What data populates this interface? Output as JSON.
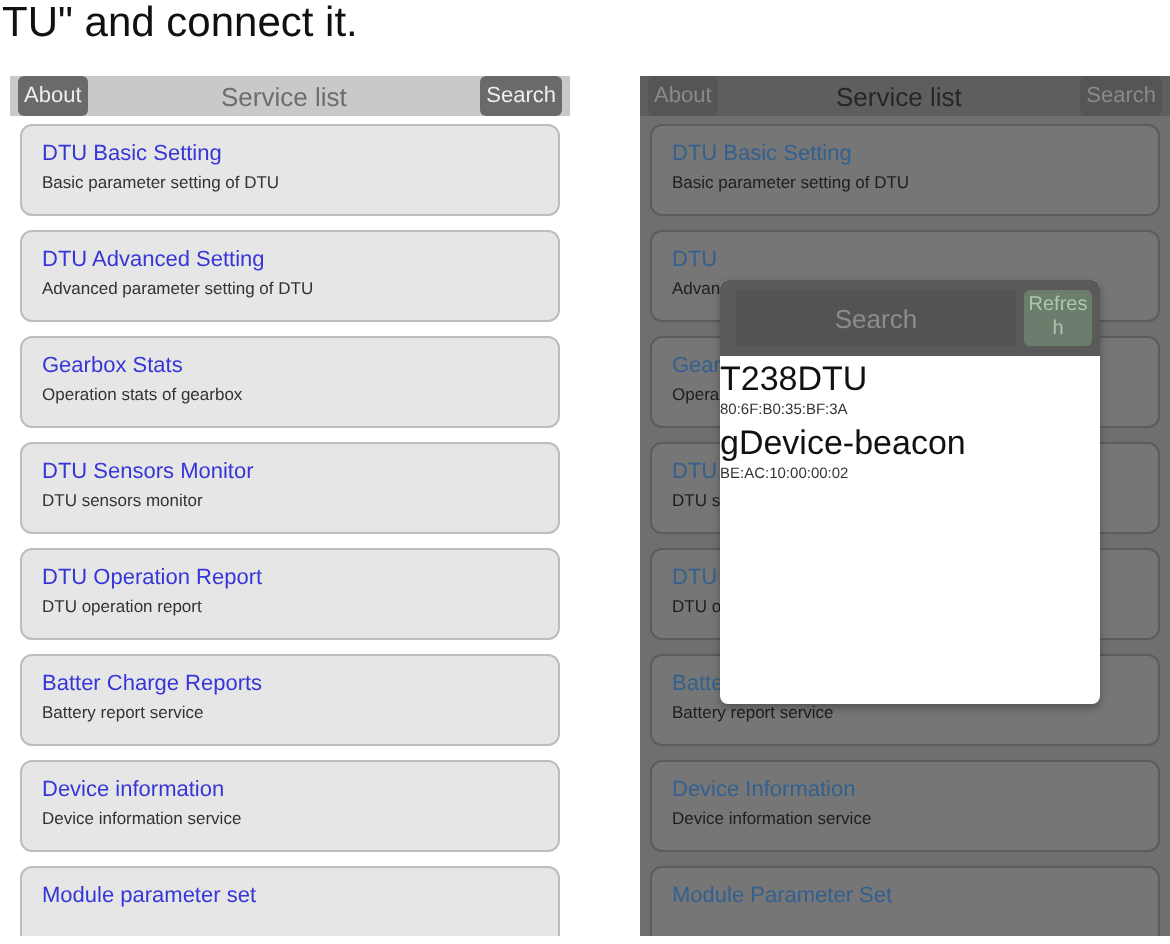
{
  "caption": "TU\" and connect it.",
  "left_screen": {
    "header": {
      "about_button": "About",
      "title": "Service list",
      "search_button": "Search"
    },
    "services": [
      {
        "title": "DTU Basic Setting",
        "subtitle": "Basic parameter setting of DTU"
      },
      {
        "title": "DTU Advanced Setting",
        "subtitle": "Advanced parameter setting of DTU"
      },
      {
        "title": "Gearbox Stats",
        "subtitle": "Operation stats of gearbox"
      },
      {
        "title": "DTU Sensors Monitor",
        "subtitle": "DTU sensors monitor"
      },
      {
        "title": "DTU Operation Report",
        "subtitle": "DTU operation report"
      },
      {
        "title": "Batter Charge Reports",
        "subtitle": "Battery report service"
      },
      {
        "title": "Device information",
        "subtitle": "Device information service"
      },
      {
        "title": "Module parameter set"
      }
    ]
  },
  "right_screen": {
    "header": {
      "about_button": "About",
      "title": "Service list",
      "search_button": "Search"
    },
    "services": [
      {
        "title": "DTU Basic Setting",
        "subtitle": "Basic parameter setting of DTU"
      },
      {
        "title": "DTU",
        "subtitle": "Advan"
      },
      {
        "title": "Gear",
        "subtitle": "Opera"
      },
      {
        "title": "DTU",
        "subtitle": "DTU s"
      },
      {
        "title": "DTU",
        "subtitle": "DTU o"
      },
      {
        "title": "Batte",
        "subtitle": "Battery report service"
      },
      {
        "title": "Device Information",
        "subtitle": "Device information service"
      },
      {
        "title": "Module Parameter Set"
      }
    ],
    "dialog": {
      "search_placeholder": "Search",
      "refresh_button": "Refresh",
      "devices": [
        {
          "name": "T238DTU",
          "address": "80:6F:B0:35:BF:3A"
        },
        {
          "name": "gDevice-beacon",
          "address": "BE:AC:10:00:00:02"
        }
      ]
    }
  }
}
